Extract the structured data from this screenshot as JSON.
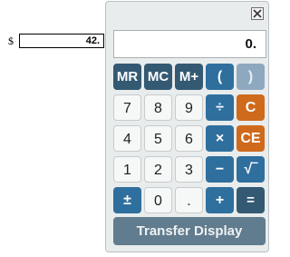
{
  "form": {
    "currency_symbol": "$",
    "amount_value": "42."
  },
  "calculator": {
    "display_value": "0.",
    "keys": {
      "mr": "MR",
      "mc": "MC",
      "mplus": "M+",
      "lparen": "(",
      "rparen": ")",
      "n7": "7",
      "n8": "8",
      "n9": "9",
      "divide": "÷",
      "clear": "C",
      "n4": "4",
      "n5": "5",
      "n6": "6",
      "multiply": "×",
      "clear_entry": "CE",
      "n1": "1",
      "n2": "2",
      "n3": "3",
      "minus": "−",
      "sqrt": "√‾",
      "negate": "±",
      "n0": "0",
      "decimal": ".",
      "plus": "+",
      "equals": "="
    },
    "transfer_label": "Transfer Display",
    "colors": {
      "dark_key": "#345a73",
      "blue_key": "#2f6f9e",
      "orange_key": "#cf6a1c",
      "light_key": "#f6f7f7",
      "transfer_bg": "#617c8e"
    },
    "icons": {
      "close": "close-x-icon"
    }
  }
}
